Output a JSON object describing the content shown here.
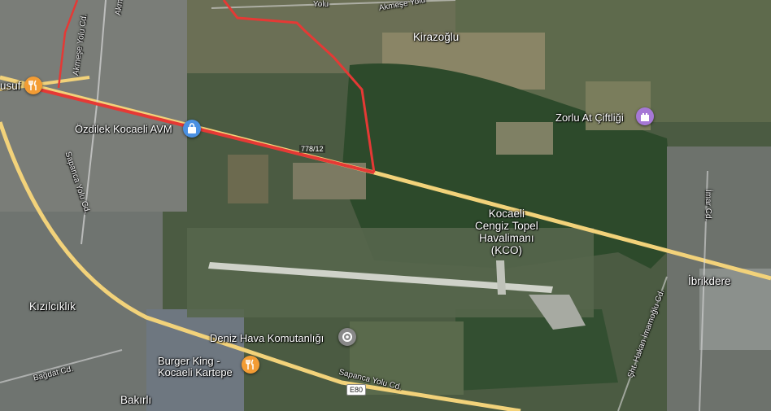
{
  "colors": {
    "route": "#e53935",
    "highway": "#f2d27a",
    "poi_orange": "#f39c34",
    "poi_blue": "#4a90e2",
    "poi_purple": "#a678d6",
    "poi_gray": "#888888",
    "forest": "#2d4a2b"
  },
  "places": {
    "kirazoglu": "Kirazoğlu",
    "kizilciklik": "Kızılcıklık",
    "ibrikdere": "İbrikdere",
    "bakirli": "Bakırlı",
    "yusuf": "usuf"
  },
  "pois": {
    "ozdilek": {
      "label": "Özdilek Kocaeli AVM",
      "icon": "shopping-bag-icon"
    },
    "zorlu": {
      "label": "Zorlu At Çiftliği",
      "icon": "castle-icon"
    },
    "deniz": {
      "label": "Deniz Hava Komutanlığı",
      "icon": "location-icon"
    },
    "burger": {
      "label_line1": "Burger King -",
      "label_line2": "Kocaeli Kartepe",
      "icon": "restaurant-icon"
    },
    "yusuf": {
      "icon": "restaurant-icon"
    }
  },
  "airport": {
    "line1": "Kocaeli",
    "line2": "Cengiz Topel",
    "line3": "Havalimanı",
    "line4": "(KCO)"
  },
  "roads": {
    "sapanca_yolu_diag": "Sapanca Yolu Cd.",
    "sapanca_yolu_bottom": "Sapanca Yolu Cd.",
    "akmese_yolu": "Akmeşe Yolu Cd.",
    "akmese_top": "Akmeşe",
    "yolu_top": "Yolu",
    "akmese_yolu_top2": "Akmeşe Yolu",
    "bagdat": "Bağdat Cd.",
    "imar": "İmar Cd.",
    "hakan": "Şht. Hakan İmamoğlu Cd.",
    "route_shield": "E80",
    "route_distance": "778/12"
  }
}
